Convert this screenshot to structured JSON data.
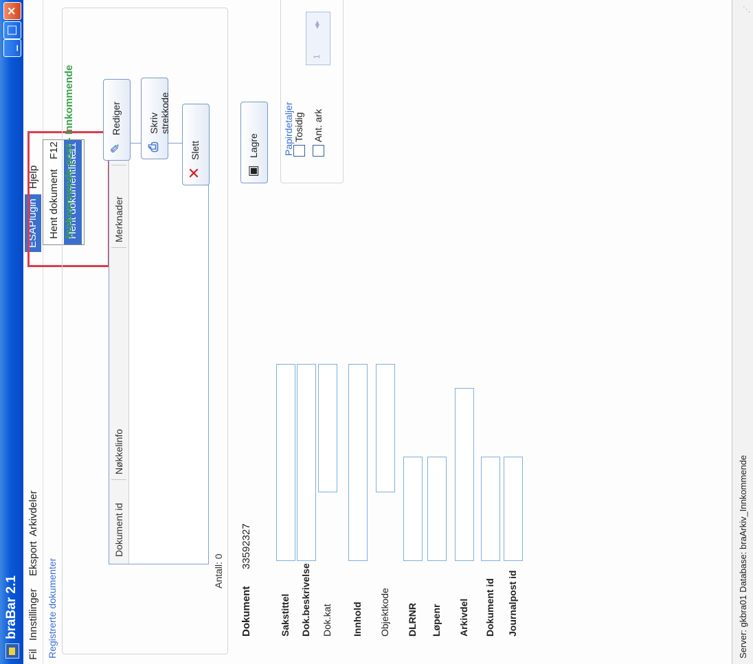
{
  "window": {
    "title": "braBar 2.1"
  },
  "menu": {
    "items": [
      "Fil",
      "Innstillinger",
      "Eksport",
      "Arkivdeler",
      "ESAPlugin",
      "Hjelp"
    ],
    "active": "ESAPlugin",
    "dropdown": [
      {
        "label": "Hent dokument",
        "shortcut": "F12"
      },
      {
        "label": "Hent dokumentliste",
        "shortcut": "F11"
      }
    ]
  },
  "registered": {
    "title": "Registrerte dokumenter",
    "columns": [
      "Dokument id",
      "Nøkkelinfo",
      "Merknader"
    ],
    "count_label": "Antall: 0"
  },
  "status_title": "Innkommende post - Innkommende",
  "actions": {
    "rediger": "Rediger",
    "skriv": "Skriv strekkode",
    "slett": "Slett",
    "lagre": "Lagre"
  },
  "paper": {
    "title": "Papirdetaljer",
    "tosidig": "Tosidig",
    "ant_ark": "Ant. ark",
    "spin_value": "1"
  },
  "form": {
    "document_label": "Dokument",
    "document_value": "33592327",
    "fields": [
      {
        "label": "Sakstittel",
        "bold": true
      },
      {
        "label": "Dok.beskrivelse",
        "bold": true
      },
      {
        "label": "Dok.kat",
        "bold": false
      },
      {
        "label": "Innhold",
        "bold": true
      },
      {
        "label": "Objektkode",
        "bold": false
      },
      {
        "label": "DLRNR",
        "bold": true
      },
      {
        "label": "Løpenr",
        "bold": true
      },
      {
        "label": "Arkivdel",
        "bold": true
      },
      {
        "label": "Dokument id",
        "bold": true
      },
      {
        "label": "Journalpost id",
        "bold": true
      }
    ]
  },
  "statusbar": {
    "text": "Server: gkbra01 Database: braArkiv_Innkommende"
  },
  "colors": {
    "titlebar": "#0a58d8",
    "accent_blue": "#3b6ed8",
    "status_green": "#3aa34e",
    "highlight_red": "#e23a4a"
  }
}
